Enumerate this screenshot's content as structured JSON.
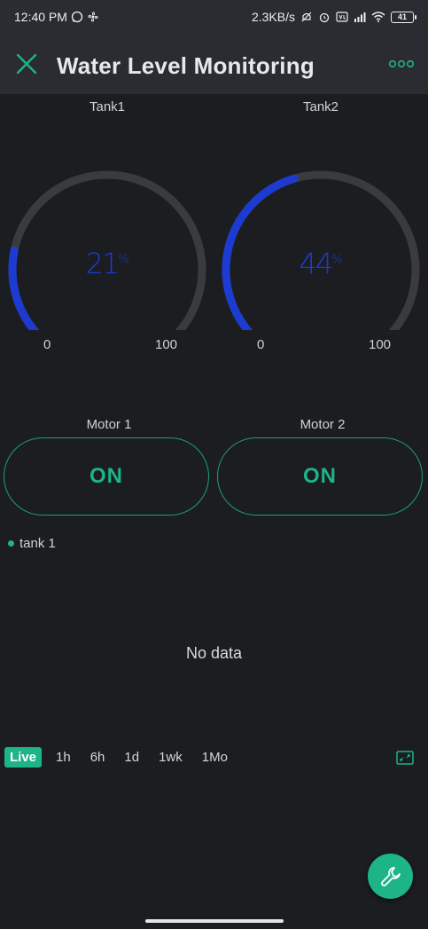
{
  "status_bar": {
    "time": "12:40 PM",
    "speed": "2.3KB/s",
    "battery": "41"
  },
  "app": {
    "title": "Water Level Monitoring"
  },
  "gauges": [
    {
      "label": "Tank1",
      "value": 21,
      "unit": "%",
      "min": "0",
      "max": "100",
      "value_text": "21"
    },
    {
      "label": "Tank2",
      "value": 44,
      "unit": "%",
      "min": "0",
      "max": "100",
      "value_text": "44"
    }
  ],
  "motors": [
    {
      "label": "Motor 1",
      "state": "ON"
    },
    {
      "label": "Motor 2",
      "state": "ON"
    }
  ],
  "chart": {
    "legend": "tank 1",
    "empty_text": "No data"
  },
  "time_ranges": [
    "Live",
    "1h",
    "6h",
    "1d",
    "1wk",
    "1Mo"
  ],
  "colors": {
    "accent": "#1db488",
    "gauge_fill": "#1d3bd1",
    "gauge_track": "#3a3b3f",
    "background": "#1c1d21"
  },
  "icons": {
    "close": "close-icon",
    "more": "more-dots-icon",
    "expand": "expand-icon",
    "fab": "wrench-icon"
  }
}
